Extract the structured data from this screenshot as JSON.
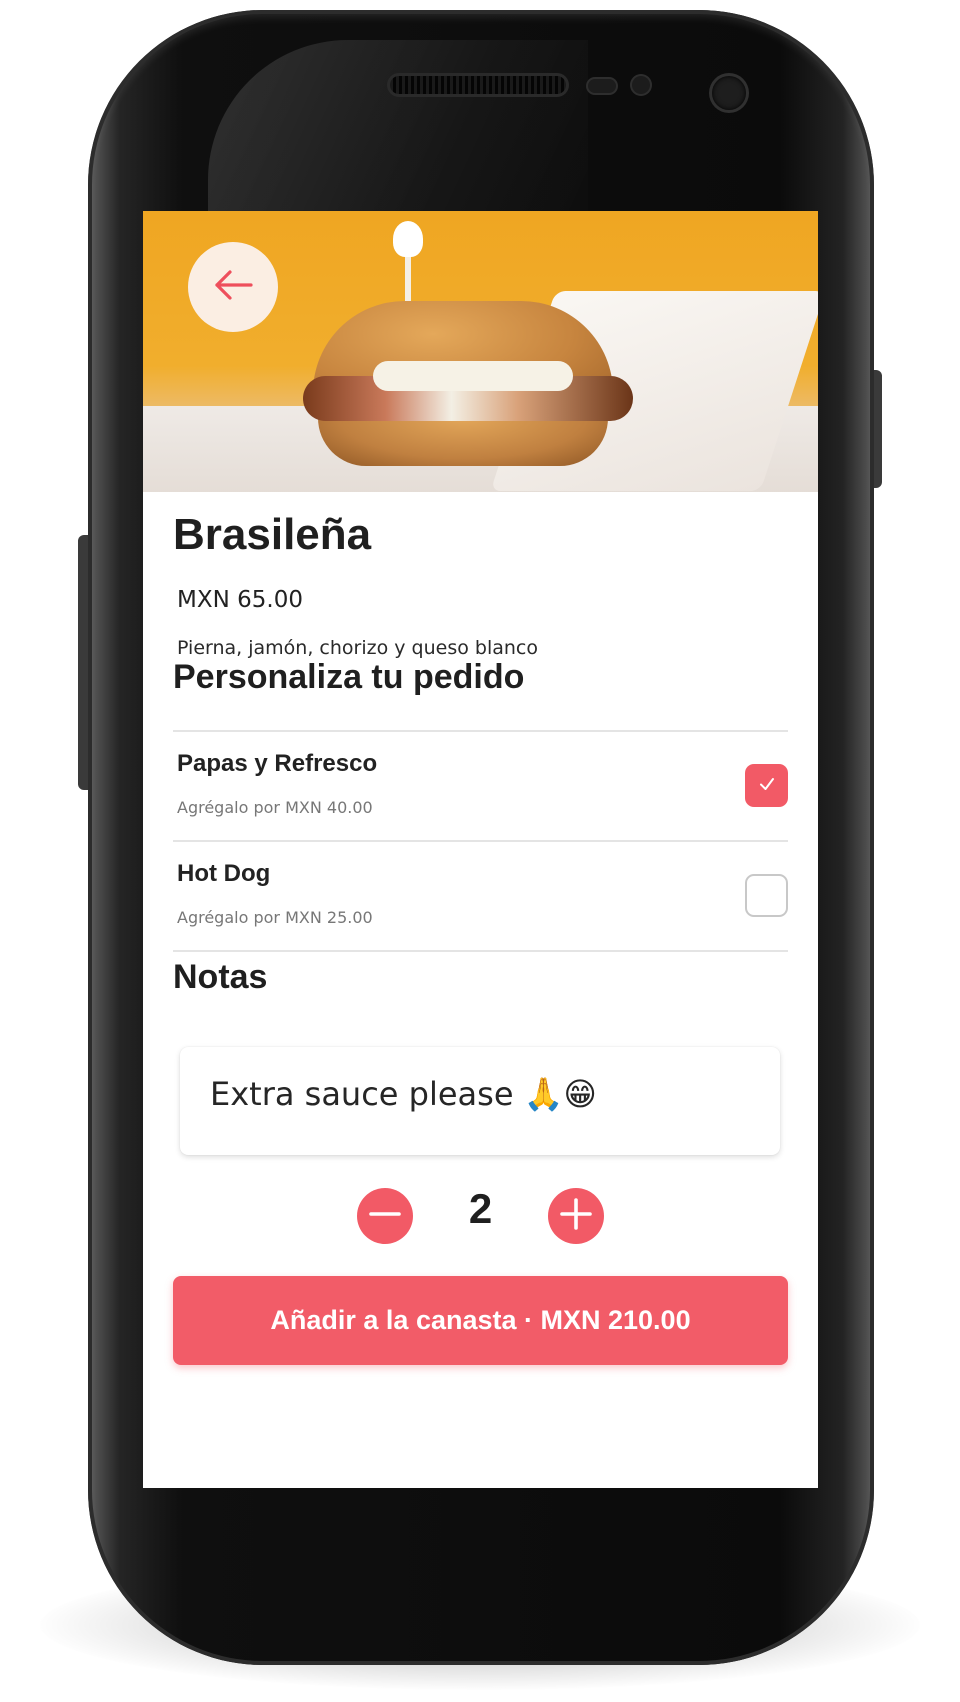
{
  "product": {
    "name": "Brasileña",
    "price": "MXN 65.00",
    "description": "Pierna, jamón, chorizo y queso blanco"
  },
  "customize": {
    "title": "Personaliza tu pedido",
    "options": [
      {
        "name": "Papas y Refresco",
        "subtitle": "Agrégalo por MXN 40.00",
        "checked": true
      },
      {
        "name": "Hot Dog",
        "subtitle": "Agrégalo por MXN 25.00",
        "checked": false
      }
    ]
  },
  "notes": {
    "title": "Notas",
    "value": "Extra sauce please 🙏😁"
  },
  "quantity": {
    "value": "2"
  },
  "add_button": {
    "label": "Añadir a la canasta · MXN 210.00"
  },
  "colors": {
    "accent": "#f25a66",
    "back_button_bg": "#fbeee3",
    "hero_bg": "#efa622"
  },
  "icons": {
    "back": "arrow-left-icon",
    "check": "check-icon",
    "minus": "minus-icon",
    "plus": "plus-icon"
  }
}
